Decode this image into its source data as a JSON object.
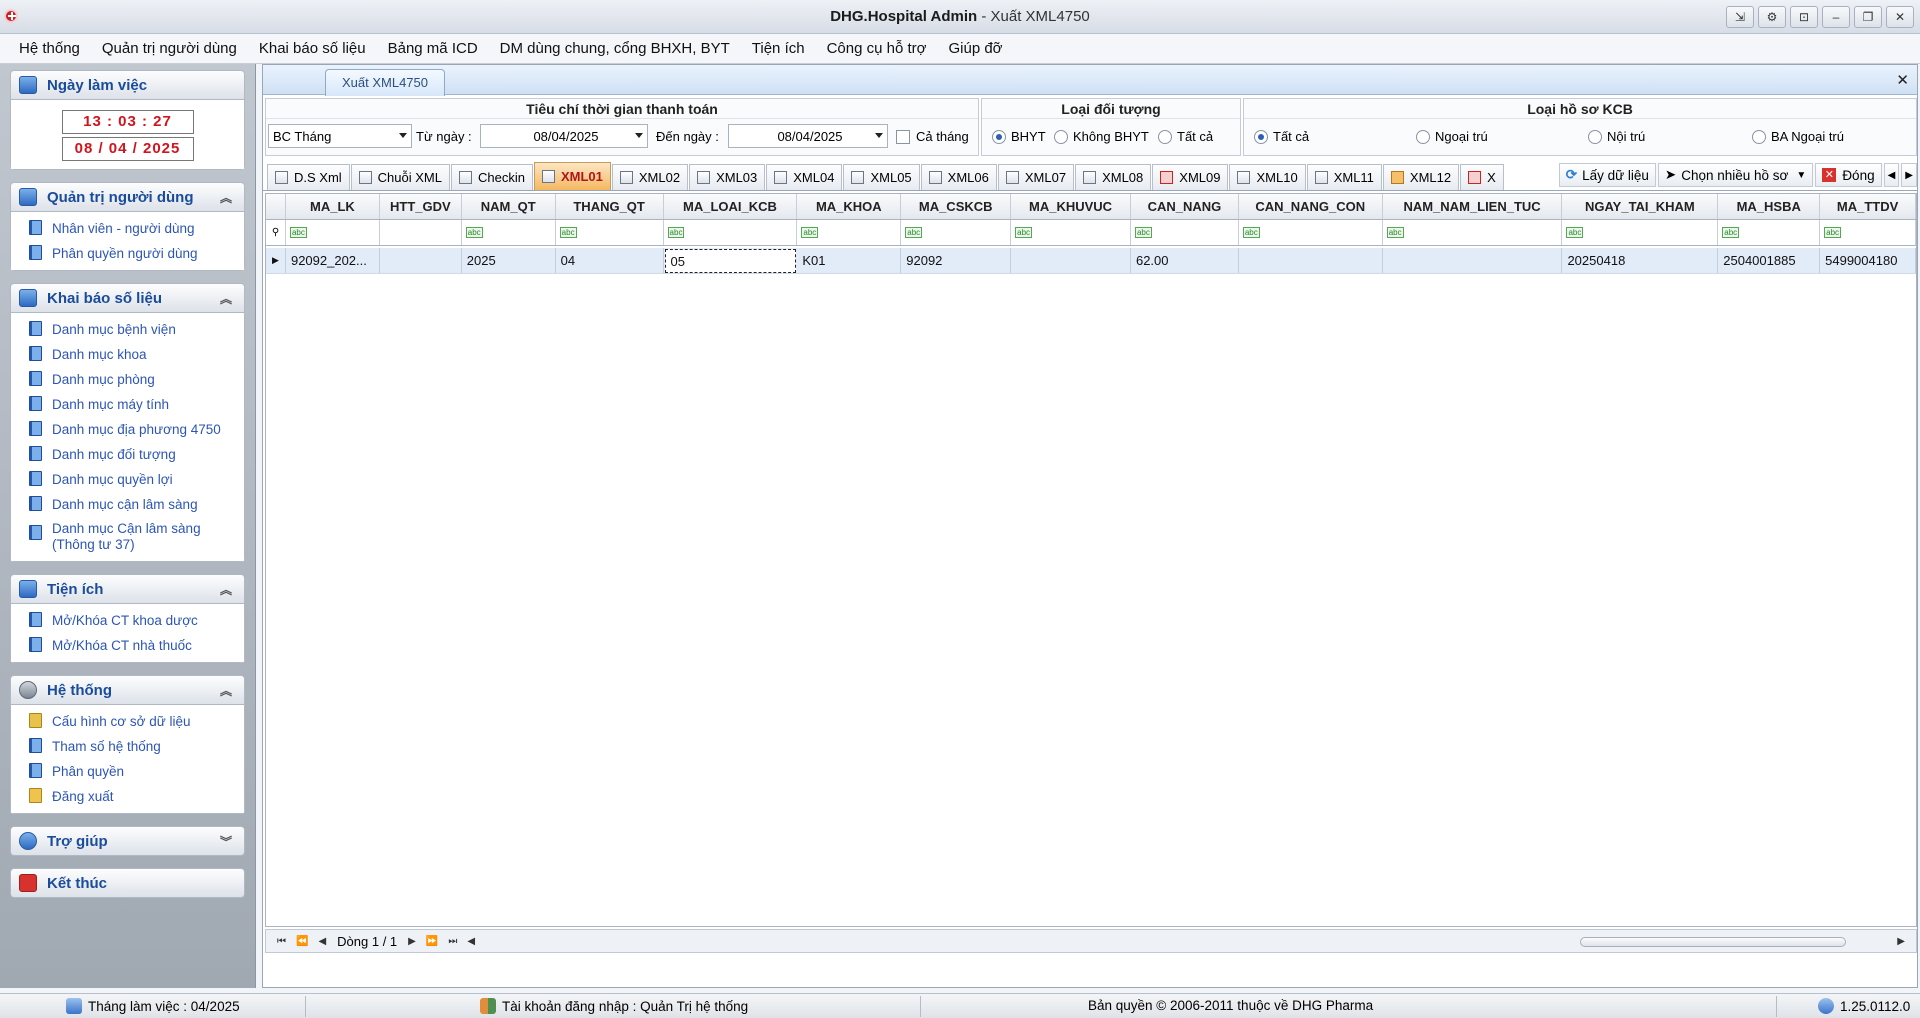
{
  "window": {
    "app_name": "DHG.Hospital Admin",
    "separator": " - ",
    "subtitle": "Xuất XML4750",
    "buttons": [
      "⇲",
      "⚙",
      "⊡",
      "–",
      "❐",
      "✕"
    ]
  },
  "menu": [
    "Hệ thống",
    "Quản trị người dùng",
    "Khai báo số liệu",
    "Bảng mã ICD",
    "DM dùng chung, cổng BHXH, BYT",
    "Tiện ích",
    "Công cụ hỗ trợ",
    "Giúp đỡ"
  ],
  "sidebar": {
    "workday": {
      "title": "Ngày làm việc",
      "time": "13 : 03 : 27",
      "date": "08 / 04 / 2025"
    },
    "users": {
      "title": "Quản trị người dùng",
      "items": [
        "Nhân viên - người dùng",
        "Phân quyền người dùng"
      ]
    },
    "data": {
      "title": "Khai báo số liệu",
      "items": [
        "Danh mục bệnh viện",
        "Danh mục khoa",
        "Danh mục phòng",
        "Danh mục máy tính",
        "Danh mục địa phương 4750",
        "Danh mục đối tượng",
        "Danh mục quyền lợi",
        "Danh mục cận lâm sàng",
        "Danh mục Cận lâm sàng (Thông  tư 37)"
      ]
    },
    "utilities": {
      "title": "Tiện ích",
      "items": [
        "Mở/Khóa CT khoa dược",
        "Mở/Khóa CT nhà thuốc"
      ]
    },
    "system": {
      "title": "Hệ thống",
      "items": [
        "Cấu hình cơ sở dữ liệu",
        "Tham số hệ thống",
        "Phân quyền",
        "Đăng xuất"
      ]
    },
    "help": {
      "title": "Trợ giúp"
    },
    "exit": {
      "title": "Kết thúc"
    }
  },
  "doc_tab": "Xuất XML4750",
  "criteria": {
    "time": {
      "title": "Tiêu chí thời gian thanh toán",
      "report_type": "BC Tháng",
      "from_label": "Từ ngày :",
      "from_date": "08/04/2025",
      "to_label": "Đến ngày :",
      "to_date": "08/04/2025",
      "whole_month": "Cả tháng"
    },
    "subject": {
      "title": "Loại đối tượng",
      "options": [
        "BHYT",
        "Không BHYT",
        "Tất cả"
      ],
      "selected": "BHYT"
    },
    "record": {
      "title": "Loại hồ sơ KCB",
      "options": [
        "Tất cả",
        "Ngoại trú",
        "Nội trú",
        "BA Ngoại trú"
      ],
      "selected": "Tất cả"
    }
  },
  "xml_tabs": [
    "D.S Xml",
    "Chuỗi XML",
    "Checkin",
    "XML01",
    "XML02",
    "XML03",
    "XML04",
    "XML05",
    "XML06",
    "XML07",
    "XML08",
    "XML09",
    "XML10",
    "XML11",
    "XML12",
    "X"
  ],
  "active_tab": "XML01",
  "toolbar": {
    "fetch": "Lấy dữ liệu",
    "pick_many": "Chọn nhiều hồ sơ",
    "close": "Đóng"
  },
  "grid": {
    "columns": [
      "MA_LK",
      "HTT_GDV",
      "NAM_QT",
      "THANG_QT",
      "MA_LOAI_KCB",
      "MA_KHOA",
      "MA_CSKCB",
      "MA_KHUVUC",
      "CAN_NANG",
      "CAN_NANG_CON",
      "NAM_NAM_LIEN_TUC",
      "NGAY_TAI_KHAM",
      "MA_HSBA",
      "MA_TTDV"
    ],
    "filter_icon": "abc",
    "rows": [
      [
        "92092_202...",
        "",
        "2025",
        "04",
        "05",
        "K01",
        "92092",
        "",
        "62.00",
        "",
        "",
        "20250418",
        "2504001885",
        "5499004180"
      ]
    ]
  },
  "footer": {
    "row_label": "Dòng 1 / 1"
  },
  "status": {
    "month": "Tháng làm việc : 04/2025",
    "account": "Tài khoản đăng nhập : Quản Trị hệ thống",
    "copyright": "Bản quyền © 2006-2011 thuộc về DHG Pharma",
    "version": "1.25.0112.0"
  },
  "colors": {
    "accent": "#2c55b5",
    "clock_red": "#d0151d",
    "active_tab": "#f4b860"
  }
}
